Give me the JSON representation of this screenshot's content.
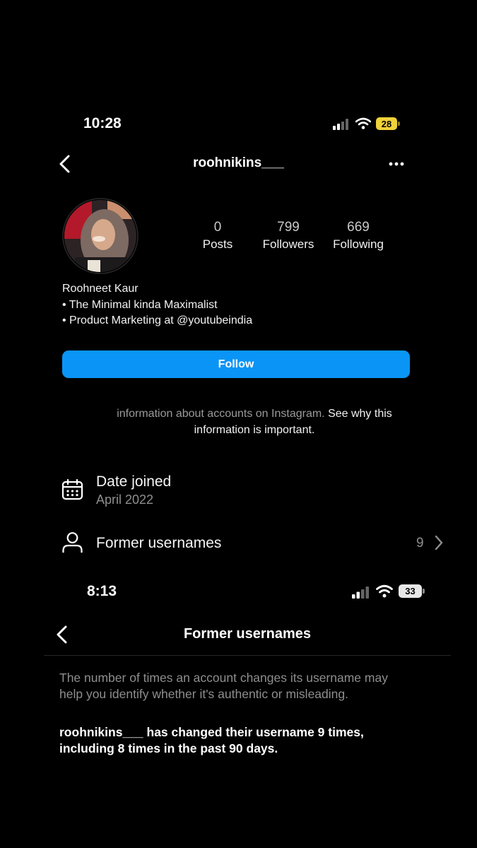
{
  "status_bar_top": {
    "time": "10:28",
    "battery": "28"
  },
  "profile": {
    "username": "roohnikins___",
    "stats": [
      {
        "value": "0",
        "label": "Posts"
      },
      {
        "value": "799",
        "label": "Followers"
      },
      {
        "value": "669",
        "label": "Following"
      }
    ],
    "bio_name": "Roohneet Kaur",
    "bio_lines": [
      "• The Minimal kinda Maximalist",
      "• Product Marketing at @youtubeindia"
    ],
    "follow_label": "Follow"
  },
  "about": {
    "info_line1": "information about accounts on Instagram.",
    "info_link1": "See why this",
    "info_link2": "information is important.",
    "date_joined_label": "Date joined",
    "date_joined_value": "April 2022",
    "former_usernames_label": "Former usernames",
    "former_usernames_count": "9"
  },
  "status_bar_bottom": {
    "time": "8:13",
    "battery": "33"
  },
  "former_usernames_page": {
    "title": "Former usernames",
    "description_line1": "The number of times an account changes its username may",
    "description_line2": "help you identify whether it's authentic or misleading.",
    "statement_line1": "roohnikins___ has changed their username 9 times,",
    "statement_line2": "including 8 times in the past 90 days."
  },
  "colors": {
    "accent": "#0a95f6",
    "battery_top": "#f0d23a",
    "battery_bottom": "#e8e8e8"
  },
  "icons": [
    "signal-icon",
    "wifi-icon",
    "battery-icon",
    "back-chevron-icon",
    "more-icon",
    "calendar-icon",
    "person-icon",
    "chevron-right-icon"
  ]
}
